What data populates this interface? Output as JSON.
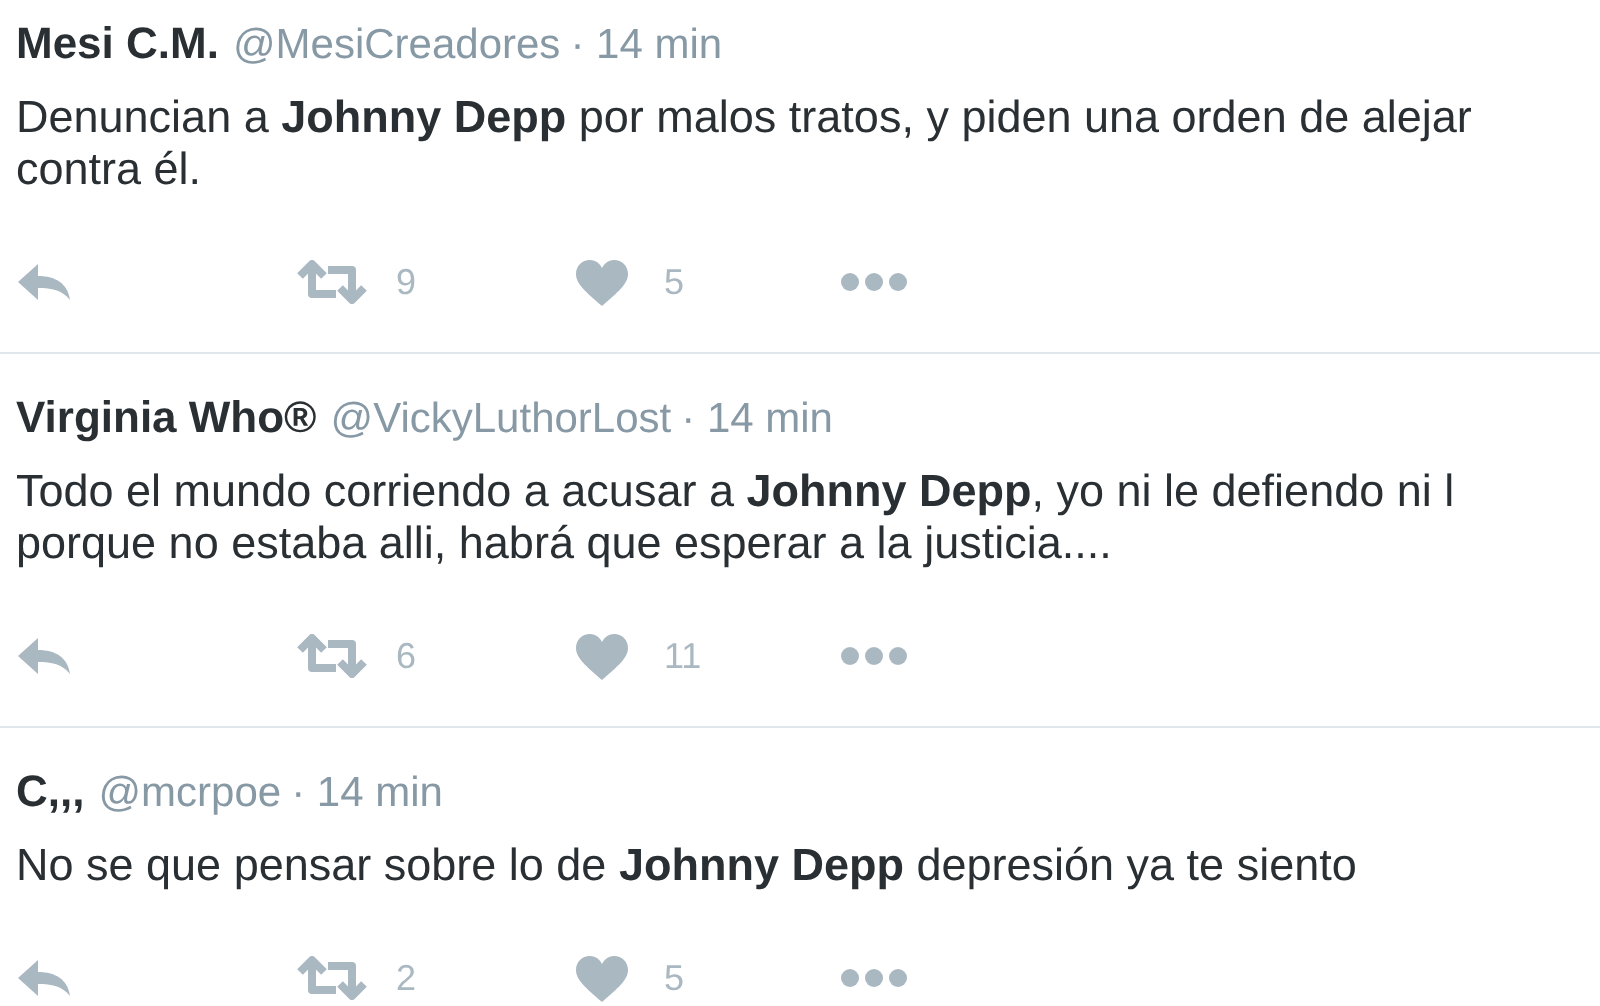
{
  "tweets": [
    {
      "name": "Mesi C.M.",
      "handle": "@MesiCreadores",
      "time": "· 14 min",
      "lines": [
        "Denuncian a **Johnny Depp** por malos tratos, y piden una orden de alejar",
        "contra él."
      ],
      "retweets": "9",
      "likes": "5"
    },
    {
      "name": "Virginia Who®",
      "handle": "@VickyLuthorLost",
      "time": "· 14 min",
      "lines": [
        "Todo el mundo corriendo a acusar a **Johnny Depp**, yo ni le defiendo ni l",
        "porque no estaba alli, habrá que esperar a la justicia...."
      ],
      "retweets": "6",
      "likes": "11"
    },
    {
      "name": "C,,,",
      "handle": "@mcrpoe",
      "time": "· 14 min",
      "lines": [
        "No se que pensar sobre lo de **Johnny Depp** depresión ya te siento"
      ],
      "retweets": "2",
      "likes": "5"
    }
  ]
}
